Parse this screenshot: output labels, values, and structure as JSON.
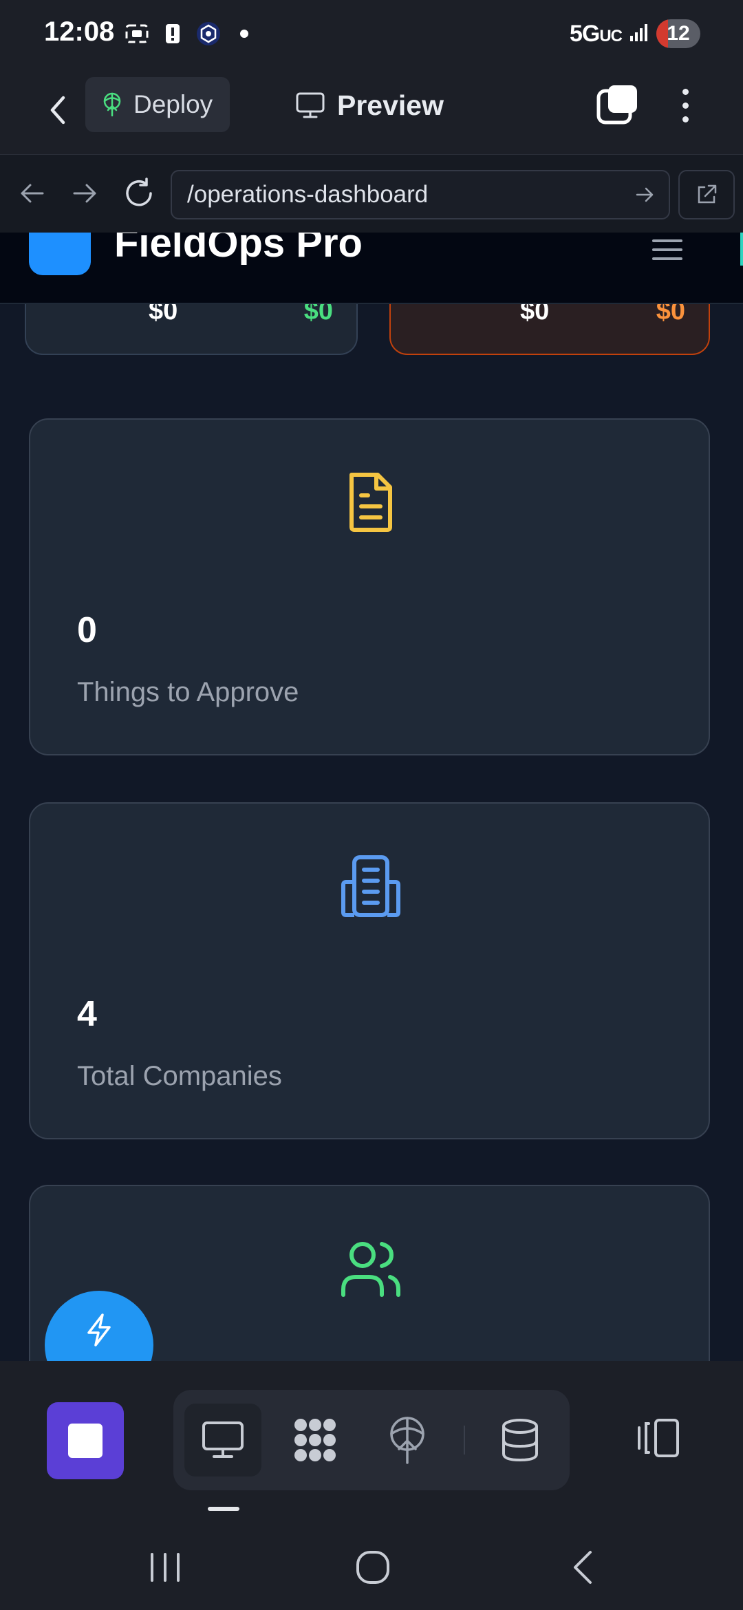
{
  "status_bar": {
    "time": "12:08",
    "network": "5G",
    "network_suffix": "UC",
    "battery": "12"
  },
  "app_bar": {
    "deploy_label": "Deploy",
    "preview_label": "Preview"
  },
  "browser": {
    "url": "/operations-dashboard"
  },
  "site": {
    "title": "FieldOps Pro",
    "summary_cards": [
      {
        "left_value": "$0",
        "right_value": "$0"
      },
      {
        "left_value": "$0",
        "right_value": "$0"
      }
    ],
    "stats": [
      {
        "value": "0",
        "label": "Things to Approve",
        "icon": "document-icon",
        "color": "#f5c542"
      },
      {
        "value": "4",
        "label": "Total Companies",
        "icon": "building-icon",
        "color": "#5b9bf0"
      },
      {
        "value": "",
        "label": "",
        "icon": "users-icon",
        "color": "#4ade80"
      }
    ]
  },
  "colors": {
    "accent_purple": "#5b3fd6",
    "fab_blue": "#2196f3",
    "positive_green": "#4ade80",
    "warning_orange": "#fb923c"
  },
  "toolbar": {
    "tools": [
      "monitor-icon",
      "apps-grid-icon",
      "deploy-tree-icon",
      "database-icon"
    ]
  }
}
